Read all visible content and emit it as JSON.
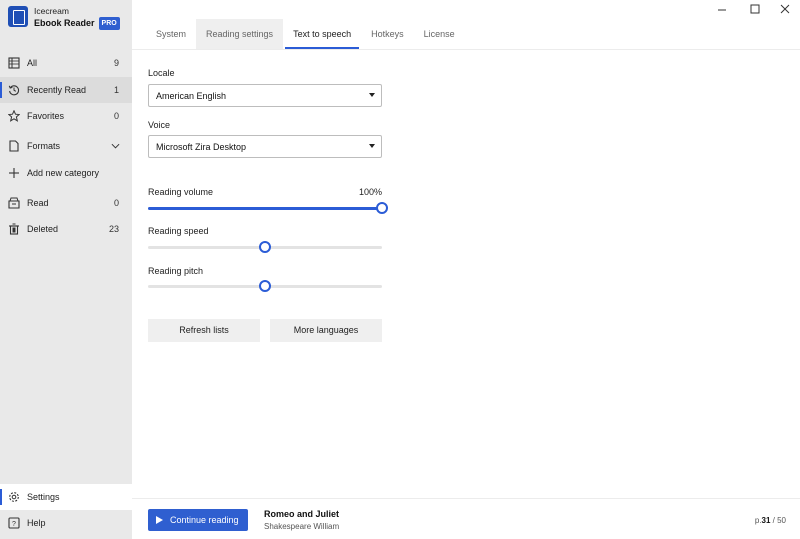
{
  "app": {
    "brand_line1": "Icecream",
    "brand_line2": "Ebook Reader",
    "badge": "PRO"
  },
  "sidebar": {
    "items": [
      {
        "label": "All",
        "count": "9",
        "icon": "grid-book-icon"
      },
      {
        "label": "Recently Read",
        "count": "1",
        "icon": "history-icon"
      },
      {
        "label": "Favorites",
        "count": "0",
        "icon": "star-icon"
      },
      {
        "label": "Formats",
        "count": "",
        "icon": "document-icon"
      },
      {
        "label": "Add new category",
        "count": "",
        "icon": "plus-icon"
      },
      {
        "label": "Read",
        "count": "0",
        "icon": "archive-icon"
      },
      {
        "label": "Deleted",
        "count": "23",
        "icon": "trash-icon"
      }
    ],
    "settings_label": "Settings",
    "help_label": "Help"
  },
  "tabs": [
    "System",
    "Reading settings",
    "Text to speech",
    "Hotkeys",
    "License"
  ],
  "tts": {
    "locale_label": "Locale",
    "locale_value": "American English",
    "voice_label": "Voice",
    "voice_value": "Microsoft Zira Desktop",
    "volume_label": "Reading volume",
    "volume_value": "100%",
    "volume_fraction": 1.0,
    "speed_label": "Reading speed",
    "speed_fraction": 0.5,
    "pitch_label": "Reading pitch",
    "pitch_fraction": 0.5,
    "refresh_label": "Refresh lists",
    "more_languages_label": "More languages"
  },
  "footer": {
    "continue_label": "Continue reading",
    "book_title": "Romeo and Juliet",
    "book_author": "Shakespeare William",
    "page_prefix": "p.",
    "page_current": "31",
    "page_total": " / 50"
  },
  "colors": {
    "accent": "#2b5cd6",
    "sidebar_bg": "#e9e9e9"
  }
}
